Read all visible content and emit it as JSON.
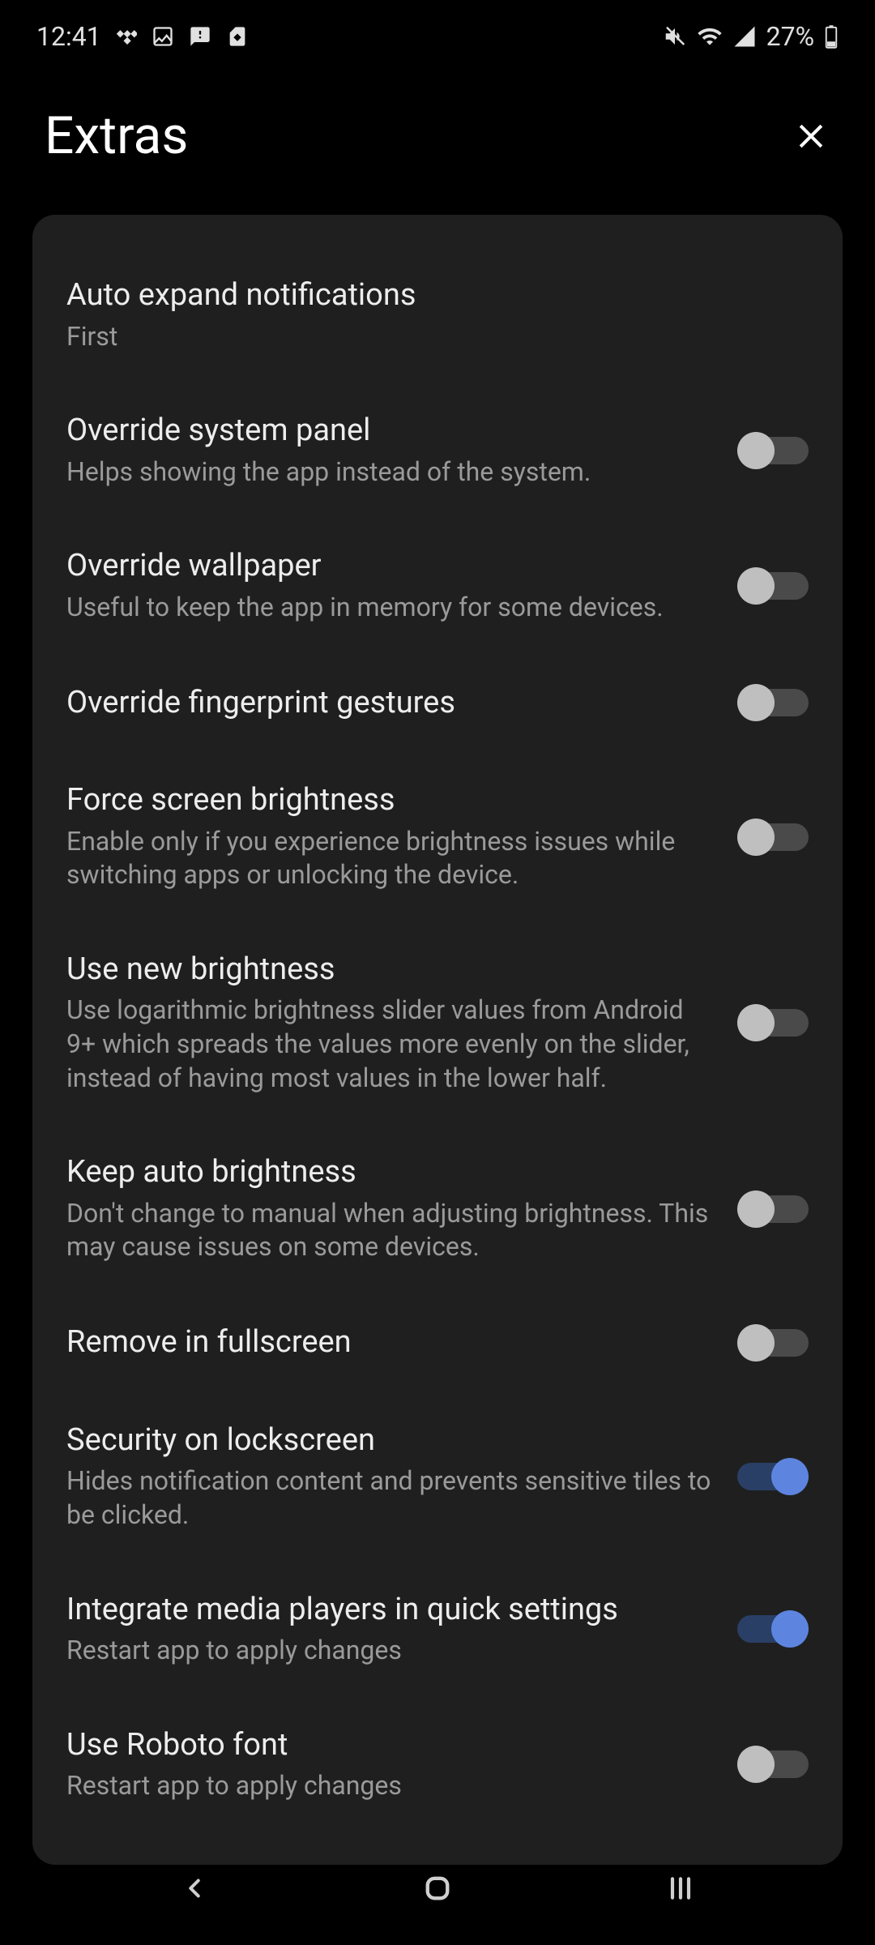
{
  "status": {
    "time": "12:41",
    "battery": "27%"
  },
  "header": {
    "title": "Extras"
  },
  "settings": [
    {
      "title": "Auto expand notifications",
      "sub": "First",
      "toggle": null
    },
    {
      "title": "Override system panel",
      "sub": "Helps showing the app instead of the system.",
      "toggle": false
    },
    {
      "title": "Override wallpaper",
      "sub": "Useful to keep the app in memory for some devices.",
      "toggle": false
    },
    {
      "title": "Override fingerprint gestures",
      "sub": "",
      "toggle": false
    },
    {
      "title": "Force screen brightness",
      "sub": "Enable only if you experience brightness issues while switching apps or unlocking the device.",
      "toggle": false
    },
    {
      "title": "Use new brightness",
      "sub": "Use logarithmic brightness slider values from Android 9+ which spreads the values more evenly on the slider, instead of having most values in the lower half.",
      "toggle": false
    },
    {
      "title": "Keep auto brightness",
      "sub": "Don't change to manual when adjusting brightness. This may cause issues on some devices.",
      "toggle": false
    },
    {
      "title": "Remove in fullscreen",
      "sub": "",
      "toggle": false
    },
    {
      "title": "Security on lockscreen",
      "sub": "Hides notification content and prevents sensitive tiles to be clicked.",
      "toggle": true
    },
    {
      "title": "Integrate media players in quick settings",
      "sub": "Restart app to apply changes",
      "toggle": true
    },
    {
      "title": "Use Roboto font",
      "sub": "Restart app to apply changes",
      "toggle": false
    }
  ]
}
